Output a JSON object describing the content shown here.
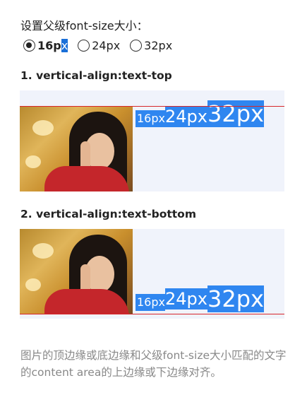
{
  "prompt": "设置父级font-size大小：",
  "font_sizes": {
    "selected": "16px",
    "selected_prefix": "16p",
    "selected_highlight": "x",
    "options": [
      "16px",
      "24px",
      "32px"
    ]
  },
  "section1": {
    "heading": "1. vertical-align:text-top",
    "tags": [
      "16px",
      "24px",
      "32px"
    ]
  },
  "section2": {
    "heading": "2. vertical-align:text-bottom",
    "tags": [
      "16px",
      "24px",
      "32px"
    ]
  },
  "footnote": "图片的顶边缘或底边缘和父级font-size大小匹配的文字的content area的上边缘或下边缘对齐。",
  "colors": {
    "tag_bg": "#2f86f0",
    "line": "#d7262a",
    "box_bg": "#f0f3fb"
  }
}
